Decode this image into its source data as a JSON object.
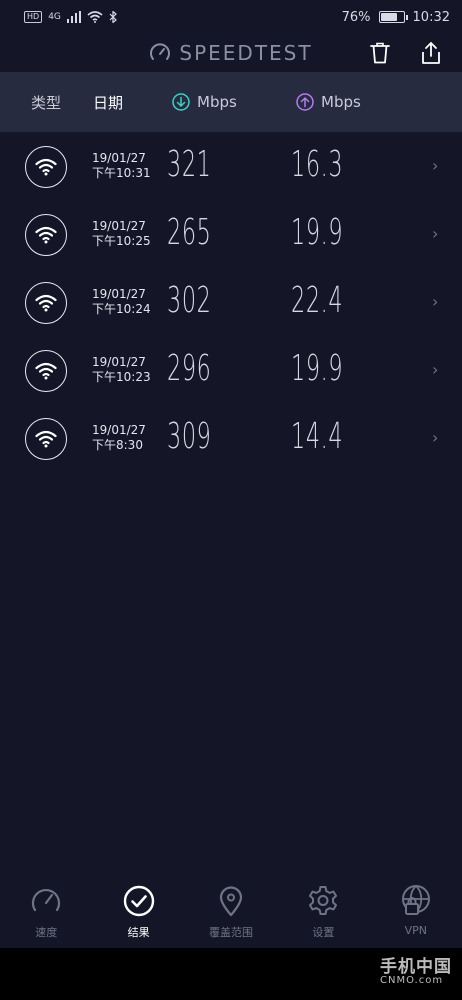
{
  "status_bar": {
    "hd": "HD",
    "network": "4G",
    "battery_percent": "76%",
    "battery_level": 0.76,
    "time": "10:32"
  },
  "header": {
    "logo_text": "SPEEDTEST",
    "trash_icon": "trash-icon",
    "share_icon": "share-icon"
  },
  "columns": {
    "type": "类型",
    "date": "日期",
    "download": "Mbps",
    "upload": "Mbps"
  },
  "colors": {
    "background": "#141627",
    "header_band": "#262b40",
    "download_accent": "#3fd0c4",
    "upload_accent": "#b57bf0"
  },
  "results": [
    {
      "type": "wifi",
      "date": "19/01/27",
      "time": "下午10:31",
      "download": "321",
      "upload": "16.3"
    },
    {
      "type": "wifi",
      "date": "19/01/27",
      "time": "下午10:25",
      "download": "265",
      "upload": "19.9"
    },
    {
      "type": "wifi",
      "date": "19/01/27",
      "time": "下午10:24",
      "download": "302",
      "upload": "22.4"
    },
    {
      "type": "wifi",
      "date": "19/01/27",
      "time": "下午10:23",
      "download": "296",
      "upload": "19.9"
    },
    {
      "type": "wifi",
      "date": "19/01/27",
      "time": "下午8:30",
      "download": "309",
      "upload": "14.4"
    }
  ],
  "nav": {
    "speed": "速度",
    "results": "结果",
    "coverage": "覆盖范围",
    "settings": "设置",
    "vpn": "VPN"
  },
  "watermark": {
    "cn": "手机中国",
    "en": "CNMO.com"
  }
}
